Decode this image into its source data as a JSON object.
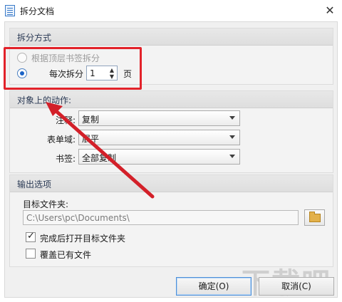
{
  "window": {
    "title": "拆分文档",
    "close_glyph": "✕"
  },
  "split_mode": {
    "title": "拆分方式",
    "by_bookmark_label": "根据顶层书签拆分",
    "per_pages_prefix": "每次拆分",
    "per_pages_value": "1",
    "per_pages_suffix": "页",
    "selected": "per_pages"
  },
  "object_actions": {
    "title": "对象上的动作:",
    "annotation_label": "注释:",
    "annotation_value": "复制",
    "form_fields_label": "表单域:",
    "form_fields_value": "展平",
    "bookmarks_label": "书签:",
    "bookmarks_value": "全部复制"
  },
  "output": {
    "title": "输出选项",
    "target_folder_label": "目标文件夹:",
    "target_folder_value": "C:\\Users\\pc\\Documents\\",
    "open_after_label": "完成后打开目标文件夹",
    "open_after_checked": true,
    "overwrite_label": "覆盖已有文件",
    "overwrite_checked": false
  },
  "buttons": {
    "ok": "确定(O)",
    "cancel": "取消(C)"
  },
  "watermark": "下载吧",
  "annotation_colors": {
    "highlight": "#e2222a",
    "arrow": "#d32029"
  },
  "icons": {
    "app": "document-icon",
    "close": "close-icon",
    "folder": "folder-icon",
    "dropdown": "chevron-down-icon",
    "spin_up": "spin-up-icon",
    "spin_down": "spin-down-icon"
  }
}
